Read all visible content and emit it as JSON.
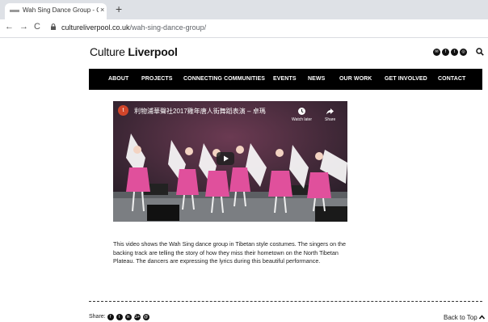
{
  "browser": {
    "tab_title": "Wah Sing Dance Group - Cultu",
    "tab_close": "×",
    "new_tab": "+",
    "url_host": "cultureliverpool.co.uk",
    "url_path": "/wah-sing-dance-group/",
    "nav": {
      "back": "←",
      "forward": "→",
      "reload": "C"
    }
  },
  "header": {
    "logo_light": "Culture ",
    "logo_bold": "Liverpool",
    "social": [
      {
        "icon": "email-icon",
        "glyph": "✉"
      },
      {
        "icon": "facebook-icon",
        "glyph": "f"
      },
      {
        "icon": "twitter-icon",
        "glyph": "t"
      },
      {
        "icon": "instagram-icon",
        "glyph": "◎"
      }
    ]
  },
  "nav": {
    "items": [
      "ABOUT",
      "PROJECTS",
      "CONNECTING COMMUNITIES",
      "EVENTS",
      "NEWS",
      "OUR WORK",
      "GET INVOLVED",
      "CONTACT"
    ]
  },
  "video": {
    "channel_initial": "t",
    "title": "利物浦華聲社2017雞年唐人街舞蹈表演 – 卓瑪",
    "watch_later": "Watch later",
    "share": "Share"
  },
  "article": {
    "caption": "This video shows the Wah Sing dance group in Tibetan style costumes. The singers on the backing track are telling the story of how they miss their hometown on the North Tibetan Plateau. The dancers are expressing the lyrics during this beautiful performance."
  },
  "footer": {
    "share_label": "Share:",
    "share_icons": [
      {
        "icon": "facebook-icon",
        "glyph": "f"
      },
      {
        "icon": "twitter-icon",
        "glyph": "t"
      },
      {
        "icon": "linkedin-icon",
        "glyph": "in"
      },
      {
        "icon": "google-plus-icon",
        "glyph": "G+"
      },
      {
        "icon": "email-icon",
        "glyph": "@"
      }
    ],
    "back_to_top": "Back to Top"
  },
  "colors": {
    "navbar": "#000000",
    "tab_strip": "#dee1e6"
  }
}
